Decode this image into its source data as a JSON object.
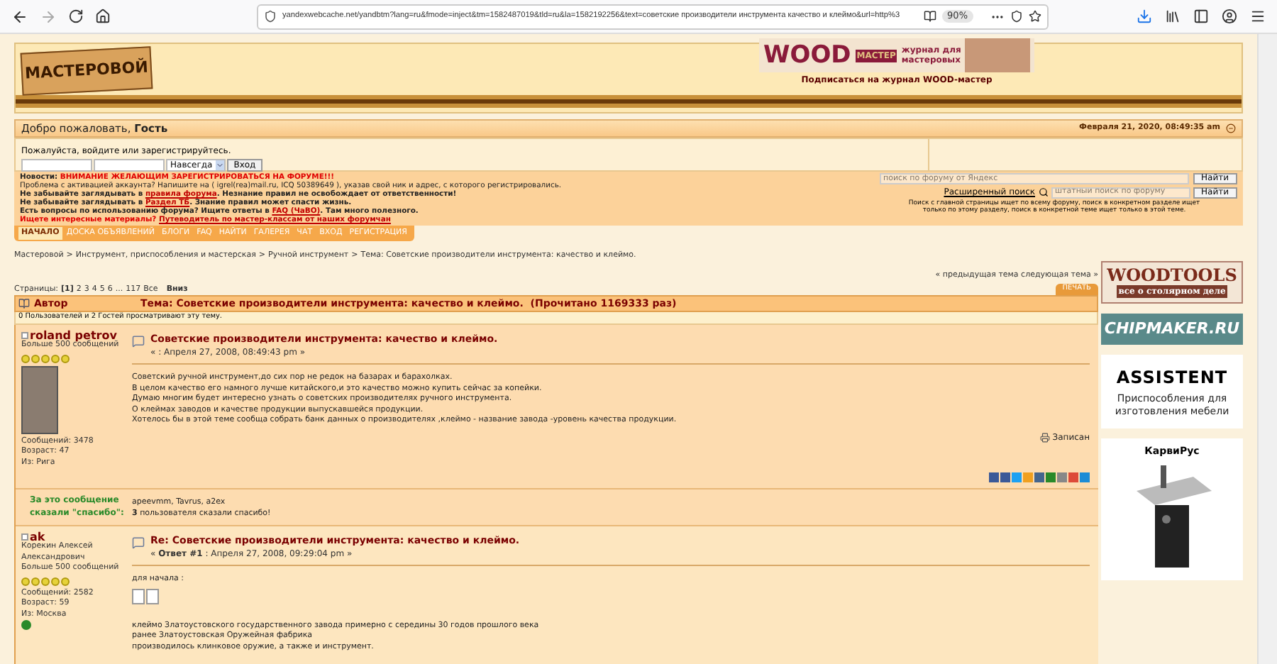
{
  "browser": {
    "url": "yandexwebcache.net/yandbtm?lang=ru&fmode=inject&tm=1582487019&tld=ru&la=1582192256&text=советские производители инструмента качество и клеймо&url=http%3",
    "zoom": "90%"
  },
  "header": {
    "logo": "МАСТЕРОВОЙ",
    "banner_word": "WOOD",
    "banner_sub": "МАСТЕР",
    "banner_tagline": "журнал для мастеровых",
    "subscribe": "Подписаться на журнал WOOD-мастер"
  },
  "welcome": {
    "text": "Добро пожаловать, **Гость**",
    "date": "Февраля 21, 2020, 08:49:35 am"
  },
  "login": {
    "prompt": "Пожалуйста, войдите или зарегистрируйтесь.",
    "duration": "Навсегда",
    "button": "Вход"
  },
  "news": [
    [
      {
        "kind": "bold",
        "text": "Новости: "
      },
      {
        "kind": "alert",
        "text": "ВНИМАНИЕ ЖЕЛАЮЩИМ ЗАРЕГИСТРИРОВАТЬСЯ НА ФОРУМЕ!!!"
      }
    ],
    [
      {
        "kind": "plain",
        "text": "Проблема с активацией аккаунта? Напишите на ( igrel(rea)mail.ru, ICQ 50389649 ), указав свой ник и адрес, с которого регистрировались."
      }
    ],
    [
      {
        "kind": "bold",
        "text": "Не забывайте заглядывать в "
      },
      {
        "kind": "link",
        "text": "правила форума"
      },
      {
        "kind": "bold",
        "text": ". Незнание правил не освобождает от ответственности!"
      }
    ],
    [
      {
        "kind": "bold",
        "text": "Не забывайте заглядывать в "
      },
      {
        "kind": "link",
        "text": "Раздел ТБ"
      },
      {
        "kind": "bold",
        "text": ". Знание правил может спасти жизнь."
      }
    ],
    [
      {
        "kind": "bold",
        "text": "Есть вопросы по использованию форума? Ищите ответы в "
      },
      {
        "kind": "link",
        "text": "FAQ (ЧаВО)"
      },
      {
        "kind": "bold",
        "text": ". Там много полезного."
      }
    ],
    [
      {
        "kind": "alert",
        "text": "Ищете интересные материалы? "
      },
      {
        "kind": "link",
        "text": "Путеводитель по мастер-классам от наших форумчан"
      }
    ]
  ],
  "search": {
    "yandex_placeholder": "поиск по форуму от Яндекс",
    "yandex_button": "Найти",
    "advanced": "Расширенный поиск",
    "placeholder": "штатный поиск по форуму",
    "button": "Найти",
    "note": "Поиск с главной страницы ищет по всему форуму, поиск в конкретном разделе ищет только по этому разделу, поиск в конкретной теме ищет только в этой теме."
  },
  "menu": [
    {
      "label": "НАЧАЛО",
      "selected": true
    },
    {
      "label": "ДОСКА ОБЪЯВЛЕНИЙ",
      "selected": false
    },
    {
      "label": "БЛОГИ",
      "selected": false
    },
    {
      "label": "FAQ",
      "selected": false
    },
    {
      "label": "НАЙТИ",
      "selected": false
    },
    {
      "label": "ГАЛЕРЕЯ",
      "selected": false
    },
    {
      "label": "ЧАТ",
      "selected": false
    },
    {
      "label": "ВХОД",
      "selected": false
    },
    {
      "label": "РЕГИСТРАЦИЯ",
      "selected": false
    }
  ],
  "breadcrumbs": {
    "separator": ">",
    "items": [
      "Мастеровой",
      "Инструмент, приспособления и мастерская",
      "Ручной инструмент",
      "Тема: Советские производители инструмента: качество и клеймо."
    ]
  },
  "topic_nav": "« предыдущая тема следующая тема »",
  "pages": {
    "label": "Страницы:",
    "items": [
      {
        "text": "[1]",
        "selected": true
      },
      {
        "text": "2",
        "selected": false
      },
      {
        "text": "3",
        "selected": false
      },
      {
        "text": "4",
        "selected": false
      },
      {
        "text": "5",
        "selected": false
      },
      {
        "text": "6",
        "selected": false
      },
      {
        "text": "...",
        "selected": false
      },
      {
        "text": "117",
        "selected": false
      },
      {
        "text": "Все",
        "selected": false
      }
    ],
    "down": "Вниз"
  },
  "print_button": "ПЕЧАТЬ",
  "topic_header": {
    "author": "Автор",
    "title": "Тема: Советские производители инструмента: качество и клеймо.  (Прочитано 1169333 раз)"
  },
  "viewing": "0 Пользователей и 2 Гостей просматривают эту тему.",
  "posts": [
    {
      "name": "roland petrov",
      "details": [
        "Больше 500 сообщений"
      ],
      "stars": 5,
      "avatar": true,
      "stats": [
        "Сообщений: 3478",
        "Возраст: 47",
        "Из: Рига"
      ],
      "location_icon": false,
      "title": "Советские производители инструмента: качество и клеймо.",
      "meta": "« : Апреля 27, 2008, 08:49:43 pm »",
      "body": [
        "Советский  ручной инструмент,до сих пор не редок на базарах и барахолках.",
        "В целом качество его намного лучше китайского,и это качество можно купить сейчас за копейки.",
        "Думаю многим будет интересно узнать о советских производителях ручного инструмента.",
        "О клеймах заводов и качестве продукции выпускавшейся продукции.",
        "Хотелось бы в этой теме сообща собрать банк данных о производителях ,клеймо - название завода -уровень качества продукции."
      ],
      "saved": "Записан",
      "share": true,
      "thanks": {
        "label": "За это сообщение сказали \"спасибо\":",
        "users": "apeevmm, Tavrus, a2ex",
        "count": "**3** пользователя сказали спасибо!"
      }
    },
    {
      "name": "ak",
      "details": [
        "Корекин Алексей",
        "Александрович",
        "Больше 500 сообщений"
      ],
      "stars": 5,
      "avatar": false,
      "stats": [
        "Сообщений: 2582",
        "Возраст: 59",
        "Из: Москва"
      ],
      "location_icon": true,
      "title": "Re: Советские производители инструмента: качество и клеймо.",
      "meta": "« **Ответ #1** : Апреля 27, 2008, 09:29:04 pm »",
      "intro": "для начала :",
      "images": [
        {
          "kind": "broken"
        },
        {
          "kind": "broken"
        }
      ],
      "body": [
        "клеймо Златоустовского государственного завода примерно с середины 30 годов прошлого века",
        "ранее Златоустовская Оружейная фабрика",
        "производилось клинковое оружие,  а также и инструмент."
      ],
      "share": false
    }
  ],
  "ads": {
    "woodtools": "WOODTOOLS",
    "woodtools_sub": "все о столярном деле",
    "chipmaker": "CHIPMAKER.RU",
    "assistent": "ASSISTENT",
    "assistent_sub": "Приспособления для изготовления мебели",
    "karavirus": "КарвиРус"
  }
}
